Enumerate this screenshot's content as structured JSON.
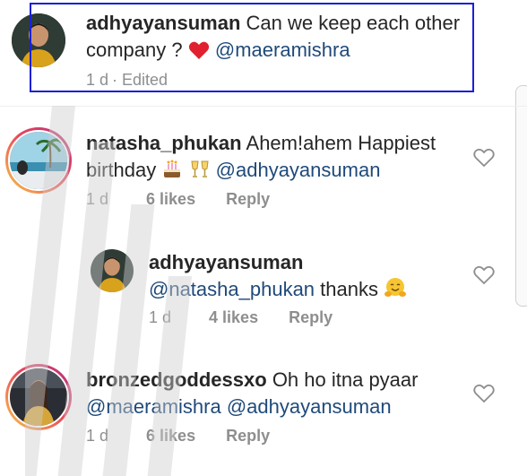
{
  "comments": [
    {
      "username": "adhyayansuman",
      "text": "Can we keep each other company ?",
      "mention": "@maeramishra",
      "meta_time": "1 d",
      "meta_edited": "· Edited"
    },
    {
      "username": "natasha_phukan",
      "text": "Ahem!ahem Happiest birthday",
      "mention": "@adhyayansuman",
      "meta_time": "1 d",
      "likes": "6 likes",
      "reply": "Reply"
    },
    {
      "username": "adhyayansuman",
      "mention": "@natasha_phukan",
      "text": "thanks",
      "meta_time": "1 d",
      "likes": "4 likes",
      "reply": "Reply"
    },
    {
      "username": "bronzedgoddessxo",
      "text": "Oh ho itna pyaar",
      "mention": "@maeramishra @adhyayansuman",
      "meta_time": "1 d",
      "likes": "6 likes",
      "reply": "Reply"
    }
  ],
  "icons": {
    "heart_emoji": "red-heart-icon",
    "cake_emoji": "birthday-cake-icon",
    "cheers_emoji": "clinking-glasses-icon",
    "hug_emoji": "hugging-face-icon",
    "like": "heart-outline-icon"
  },
  "colors": {
    "highlight_border": "#1a1fd6",
    "mention": "#1f4a7a",
    "meta": "#8e8e8e"
  }
}
